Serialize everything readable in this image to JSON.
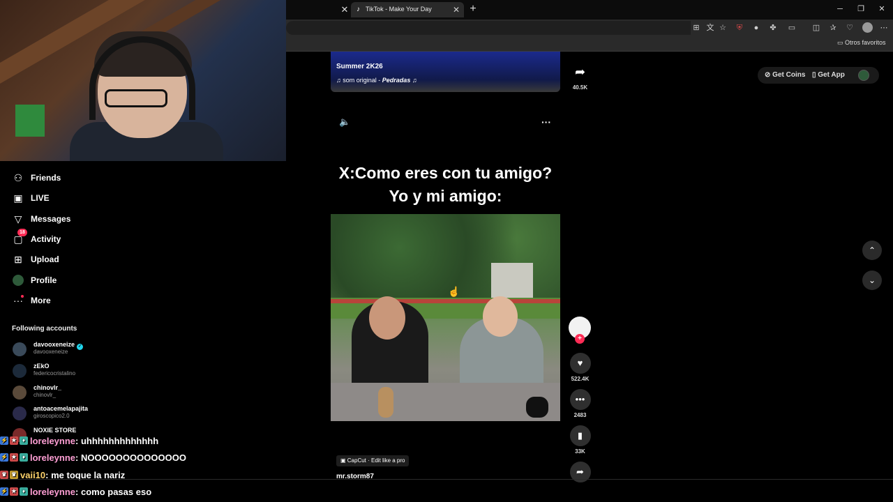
{
  "browser": {
    "tab_title": "TikTok - Make Your Day",
    "bookmark_folder": "Otros favoritos"
  },
  "sidebar": {
    "nav": [
      {
        "label": "Friends",
        "icon": "friends-icon"
      },
      {
        "label": "LIVE",
        "icon": "live-icon"
      },
      {
        "label": "Messages",
        "icon": "messages-icon"
      },
      {
        "label": "Activity",
        "icon": "activity-icon",
        "badge": "18"
      },
      {
        "label": "Upload",
        "icon": "upload-icon"
      },
      {
        "label": "Profile",
        "icon": "profile-icon"
      },
      {
        "label": "More",
        "icon": "more-icon"
      }
    ],
    "following_title": "Following accounts",
    "accounts": [
      {
        "name": "davooxeneize",
        "handle": "davooxeneize",
        "verified": true
      },
      {
        "name": "zEkO",
        "handle": "federicocristalino"
      },
      {
        "name": "chinovlr_",
        "handle": "chinovlr_"
      },
      {
        "name": "antoacemelapajita",
        "handle": "giroscopico2.0"
      },
      {
        "name": "NOXIE STORE",
        "handle": ""
      }
    ]
  },
  "chat": [
    {
      "user": "loreleynne",
      "message": ": uhhhhhhhhhhhhh",
      "color": "#ff9fd5"
    },
    {
      "user": "loreleynne",
      "message": ": NOOOOOOOOOOOOOO",
      "color": "#ff9fd5"
    },
    {
      "user": "vaii10",
      "message": ": me toque la nariz",
      "color": "#ffd36b"
    },
    {
      "user": "loreleynne",
      "message": ": como pasas eso",
      "color": "#ff9fd5"
    }
  ],
  "feed": {
    "prev_video": {
      "desc": "Summer 2K26",
      "sound_prefix": "som original - ",
      "sound_name": "Pedradas",
      "share_count": "40.5K"
    },
    "caption_line1": "X:Como eres con tu amigo?",
    "caption_line2": "Yo y mi amigo:",
    "capcut_label": "CapCut · Edit like a pro",
    "author": "mr.storm87",
    "actions": {
      "likes": "522.4K",
      "comments": "2483",
      "saves": "33K"
    }
  },
  "header": {
    "get_coins": "Get Coins",
    "get_app": "Get App"
  }
}
